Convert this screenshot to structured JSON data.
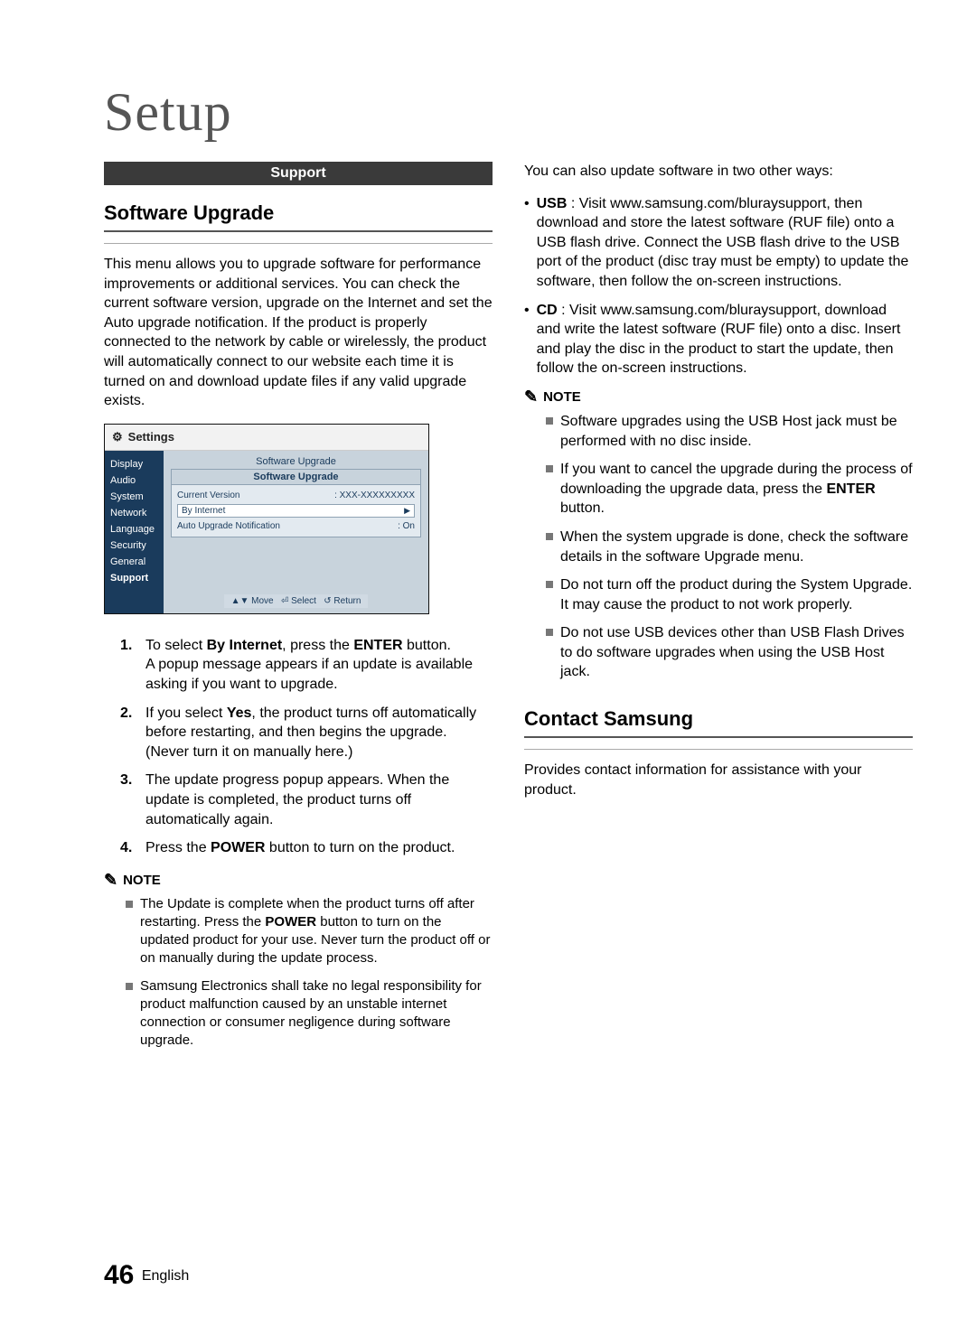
{
  "page": {
    "title": "Setup",
    "number": "46",
    "language": "English"
  },
  "left": {
    "supportBar": "Support",
    "heading1": "Software Upgrade",
    "intro": "This menu allows you to upgrade software for performance improvements or additional services. You can check the current software version, upgrade on the Internet and set the Auto upgrade notification. If the product is properly connected to the network by cable or wirelessly, the product will automatically connect to our website each time it is turned on and download update files if any valid upgrade exists.",
    "settings": {
      "title": "Settings",
      "sidebar": [
        "Display",
        "Audio",
        "System",
        "Network",
        "Language",
        "Security",
        "General",
        "Support"
      ],
      "panelTitle": "Software Upgrade",
      "panelHeader": "Software Upgrade",
      "row1Label": "Current Version",
      "row1Value": ": XXX-XXXXXXXXX",
      "row2Label": "By Internet",
      "row3Label": "Auto Upgrade Notification",
      "row3Value": ": On",
      "footerMove": "Move",
      "footerSelect": "Select",
      "footerReturn": "Return"
    },
    "steps": [
      {
        "num": "1.",
        "pre": "To select ",
        "b1": "By Internet",
        "mid": ", press the ",
        "b2": "ENTER",
        "post": " button.",
        "extra": "A popup message appears if an update is available asking if you want to upgrade."
      },
      {
        "num": "2.",
        "pre": "If you select ",
        "b1": "Yes",
        "post": ", the product turns off automatically before restarting, and then begins the upgrade. (Never turn it on manually here.)"
      },
      {
        "num": "3.",
        "text": "The update progress popup appears. When the update is completed, the product turns off automatically again."
      },
      {
        "num": "4.",
        "pre": "Press the ",
        "b1": "POWER",
        "post": " button to turn on the product."
      }
    ],
    "noteLabel": "NOTE",
    "notes": [
      {
        "pre": "The Update is complete when the product turns off after restarting. Press the ",
        "b1": "POWER",
        "post": " button to turn on the updated product for your use. Never turn the product off or on manually during the update process."
      },
      {
        "text": "Samsung Electronics shall take no legal responsibility for product malfunction caused by an unstable internet connection or consumer negligence during software upgrade."
      }
    ]
  },
  "right": {
    "introOther": "You can also update software in two other ways:",
    "bullets": [
      {
        "b1": "USB",
        "text": " : Visit www.samsung.com/bluraysupport, then download and store the latest software (RUF file) onto a USB flash drive. Connect the USB flash drive to the USB port of the product (disc tray must be empty) to update the software, then follow the on-screen instructions."
      },
      {
        "b1": "CD",
        "text": " : Visit www.samsung.com/bluraysupport, download and write the latest software (RUF file) onto a disc. Insert and play the disc in the product to start the update, then follow the on-screen instructions."
      }
    ],
    "noteLabel": "NOTE",
    "notes": [
      {
        "text": "Software upgrades using the USB Host jack must be performed with no disc inside."
      },
      {
        "pre": "If you want to cancel the upgrade during the process of downloading the upgrade data, press the ",
        "b1": "ENTER",
        "post": " button."
      },
      {
        "text": "When the system upgrade is done, check the software details in the software Upgrade menu."
      },
      {
        "text": "Do not turn off the product during the System Upgrade. It may cause the product to not work properly."
      },
      {
        "text": "Do not use USB devices other than USB Flash Drives to do software upgrades when using the USB Host jack."
      }
    ],
    "heading2": "Contact Samsung",
    "contactText": "Provides contact information for assistance with your product."
  }
}
